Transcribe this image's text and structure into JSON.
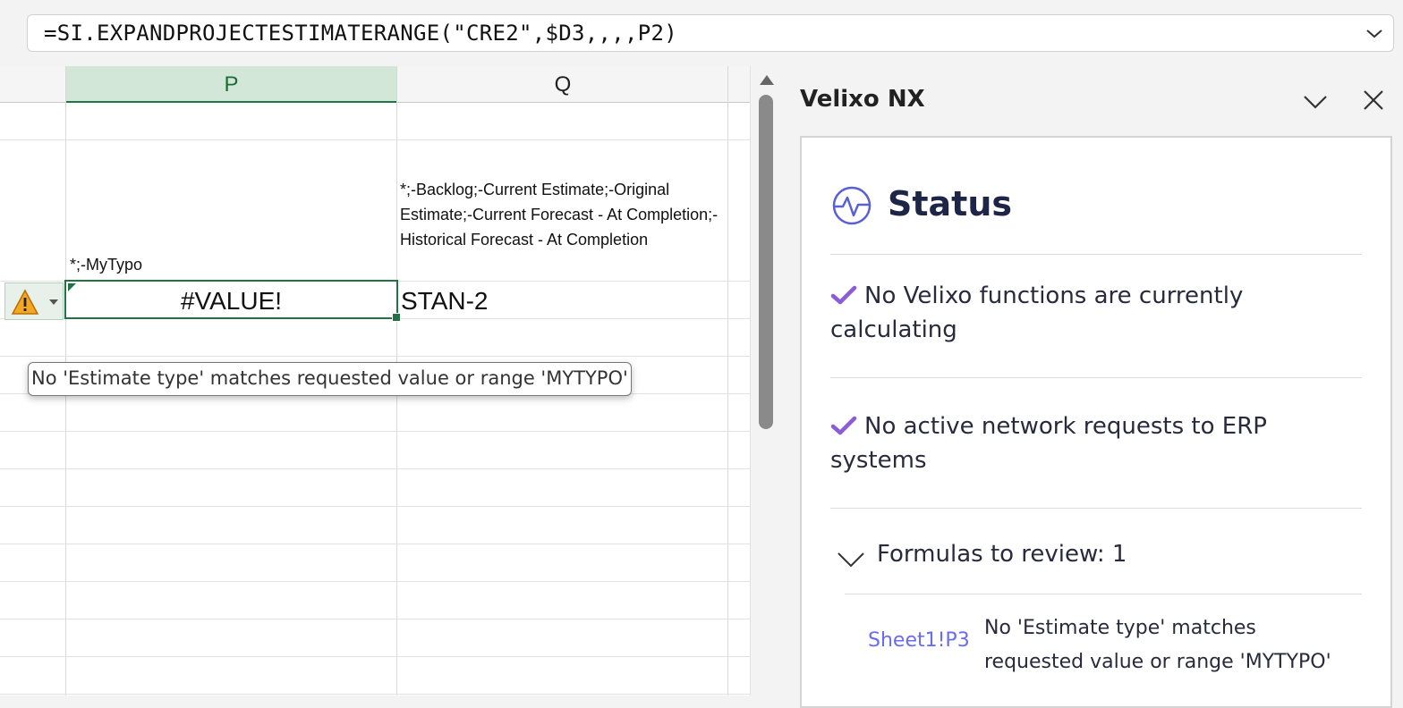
{
  "formula_bar": {
    "formula": "=SI.EXPANDPROJECTESTIMATERANGE(\"CRE2\",$D3,,,,P2)",
    "expand_icon": "chevron-down-icon"
  },
  "grid": {
    "columns": [
      {
        "label": "P",
        "selected": true
      },
      {
        "label": "Q",
        "selected": false
      }
    ],
    "cells": {
      "p2": "*;-MyTypo",
      "q2": "*;-Backlog;-Current Estimate;-Original Estimate;-Current Forecast - At Completion;-Historical Forecast - At Completion",
      "p3": "#VALUE!",
      "q3": "STAN-2"
    },
    "error_button_icon": "warning-triangle-icon",
    "error_tooltip": "No 'Estimate type' matches requested value or range 'MYTYPO'"
  },
  "task_pane": {
    "title": "Velixo NX",
    "status_title": "Status",
    "status_items": [
      "No Velixo functions are currently calculating",
      "No active network requests to ERP systems"
    ],
    "review_label": "Formulas to review: 1",
    "review_items": [
      {
        "cell_ref": "Sheet1!P3",
        "message": "No 'Estimate type' matches requested value or range 'MYTYPO'"
      }
    ],
    "colors": {
      "accent": "#6a6cf0",
      "check": "#8b5cd6",
      "heading": "#1e2647"
    }
  }
}
